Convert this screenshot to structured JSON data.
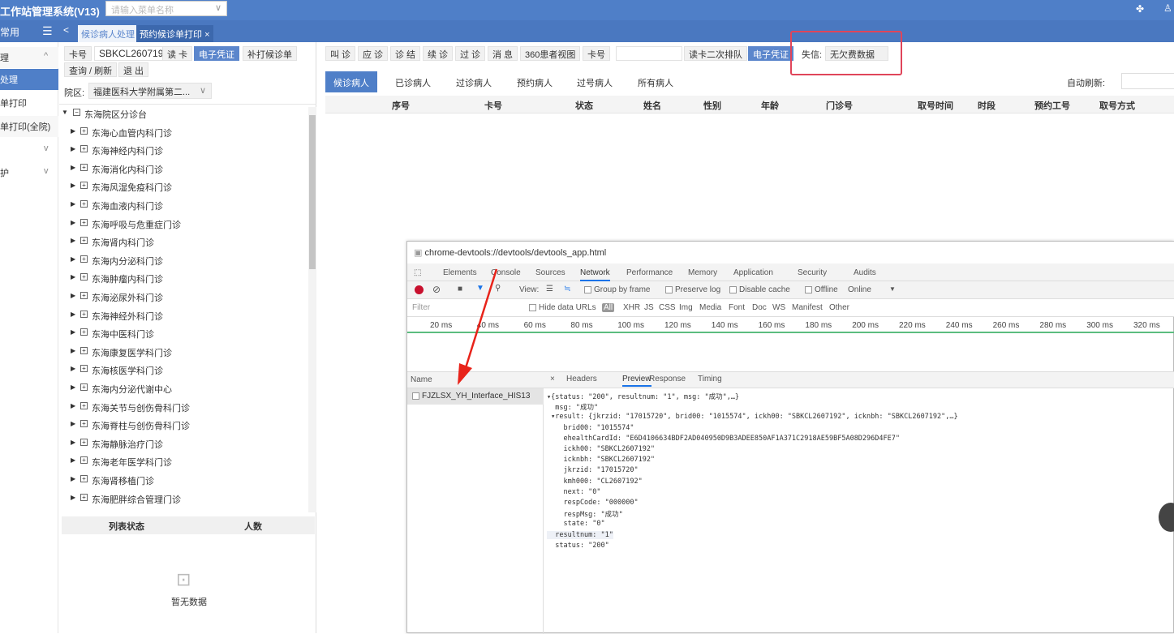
{
  "app": {
    "title": "工作站管理系统(V13)",
    "menu_search_placeholder": "请输入菜单名称"
  },
  "nav": {
    "collapsed_label": "常用",
    "back": "<",
    "tabs": [
      {
        "label": "候诊病人处理"
      },
      {
        "label": "预约候诊单打印",
        "close": "×"
      }
    ]
  },
  "sidebar": {
    "items": [
      {
        "label": "理",
        "chev": "^"
      },
      {
        "label": "处理"
      },
      {
        "label": "单打印"
      },
      {
        "label": "单打印(全院)"
      },
      {
        "label": "",
        "chev": "v"
      },
      {
        "label": "护",
        "chev": "v"
      }
    ]
  },
  "left": {
    "card_label": "卡号",
    "card_value": "SBKCL260719",
    "read_card": "读 卡",
    "e_voucher": "电子凭证",
    "reprint": "补打候诊单",
    "query": "查询 / 刷新",
    "exit": "退 出",
    "campus_label": "院区:",
    "campus_value": "福建医科大学附属第二...",
    "tree_root": "东海院区分诊台",
    "tree_items": [
      "东海心血管内科门诊",
      "东海神经内科门诊",
      "东海消化内科门诊",
      "东海风湿免疫科门诊",
      "东海血液内科门诊",
      "东海呼吸与危重症门诊",
      "东海肾内科门诊",
      "东海内分泌科门诊",
      "东海肿瘤内科门诊",
      "东海泌尿外科门诊",
      "东海神经外科门诊",
      "东海中医科门诊",
      "东海康复医学科门诊",
      "东海核医学科门诊",
      "东海内分泌代谢中心",
      "东海关节与创伤骨科门诊",
      "东海脊柱与创伤骨科门诊",
      "东海静脉治疗门诊",
      "东海老年医学科门诊",
      "东海肾移植门诊",
      "东海肥胖综合管理门诊"
    ],
    "status_headers": [
      "列表状态",
      "人数"
    ],
    "empty": "暂无数据"
  },
  "toolbar": {
    "buttons": [
      "叫 诊",
      "应 诊",
      "诊 结",
      "续 诊",
      "过 诊",
      "消 息",
      "360患者视图"
    ],
    "card_label": "卡号",
    "card_value": "",
    "read_queue": "读卡二次排队",
    "e_voucher": "电子凭证",
    "credit_label": "失信:",
    "credit_value": "无欠费数据"
  },
  "patient_tabs": [
    "候诊病人",
    "已诊病人",
    "过诊病人",
    "预约病人",
    "过号病人",
    "所有病人"
  ],
  "auto_refresh_label": "自动刷新:",
  "table_headers": [
    "序号",
    "卡号",
    "状态",
    "姓名",
    "性别",
    "年龄",
    "门诊号",
    "取号时间",
    "时段",
    "预约工号",
    "取号方式"
  ],
  "devtools": {
    "url": "chrome-devtools://devtools/devtools_app.html",
    "tabs": [
      "Elements",
      "Console",
      "Sources",
      "Network",
      "Performance",
      "Memory",
      "Application",
      "Security",
      "Audits"
    ],
    "active_tab": "Network",
    "view_label": "View:",
    "group_by_frame": "Group by frame",
    "preserve_log": "Preserve log",
    "disable_cache": "Disable cache",
    "offline": "Offline",
    "online": "Online",
    "filter_placeholder": "Filter",
    "hide_data_urls": "Hide data URLs",
    "filter_types": [
      "All",
      "XHR",
      "JS",
      "CSS",
      "Img",
      "Media",
      "Font",
      "Doc",
      "WS",
      "Manifest",
      "Other"
    ],
    "ticks": [
      "20 ms",
      "40 ms",
      "60 ms",
      "80 ms",
      "100 ms",
      "120 ms",
      "140 ms",
      "160 ms",
      "180 ms",
      "200 ms",
      "220 ms",
      "240 ms",
      "260 ms",
      "280 ms",
      "300 ms",
      "320 ms"
    ],
    "name_header": "Name",
    "request": "FJZLSX_YH_Interface_HIS13",
    "detail_tabs": [
      "Headers",
      "Preview",
      "Response",
      "Timing"
    ],
    "close": "×",
    "json_lines": [
      "▾{status: \"200\", resultnum: \"1\", msg: \"成功\",…}",
      "  msg: \"成功\"",
      " ▾result: {jkrzid: \"17015720\", brid00: \"1015574\", ickh00: \"SBKCL2607192\", icknbh: \"SBKCL2607192\",…}",
      "    brid00: \"1015574\"",
      "    ehealthCardId: \"E6D4106634BDF2AD040950D9B3ADEE850AF1A371C2918AE59BF5A08D296D4FE7\"",
      "    ickh00: \"SBKCL2607192\"",
      "    icknbh: \"SBKCL2607192\"",
      "    jkrzid: \"17015720\"",
      "    kmh000: \"CL2607192\"",
      "    next: \"0\"",
      "    respCode: \"000000\"",
      "    respMsg: \"成功\"",
      "    state: \"0\"",
      "  resultnum: \"1\"",
      "  status: \"200\""
    ]
  }
}
